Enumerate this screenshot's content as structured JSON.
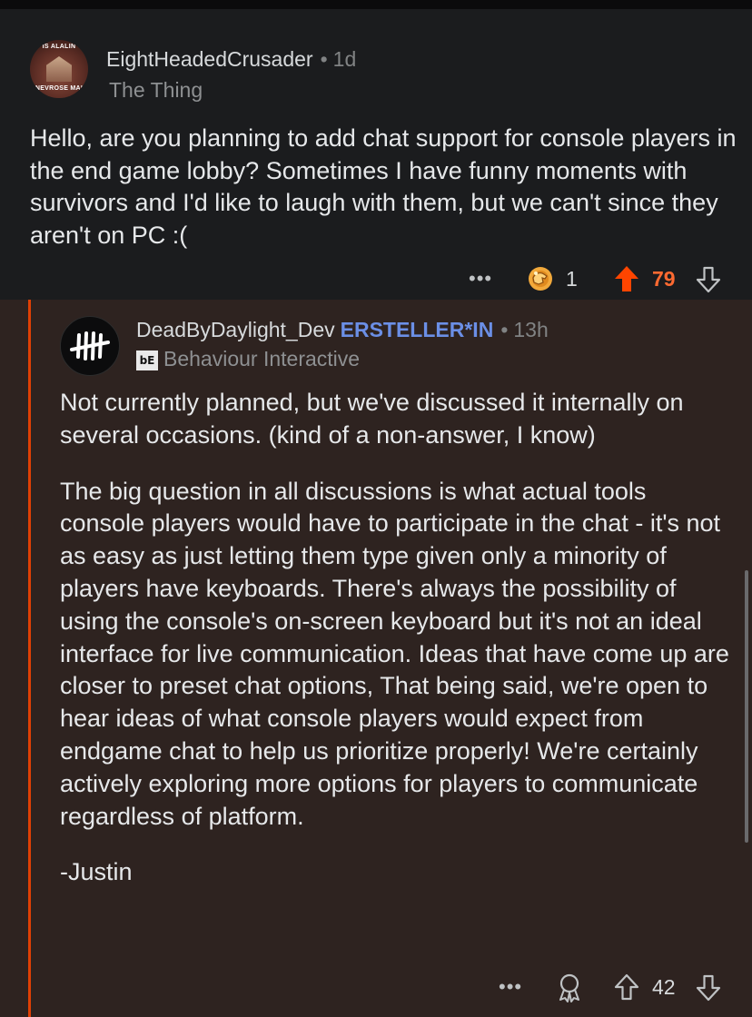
{
  "comments": [
    {
      "author": "EightHeadedCrusader",
      "separator": "•",
      "age": "1d",
      "flair": "The Thing",
      "avatar_text_top": "IS ALALIN",
      "avatar_text_bottom": "NEVROSE MAI",
      "body": "Hello, are you planning to add chat support for console players in the end game lobby? Sometimes I have funny moments with survivors and I'd like to laugh with them, but we can't since they aren't on PC :(",
      "more_label": "•••",
      "award_count": "1",
      "score": "79",
      "upvoted": true
    },
    {
      "author": "DeadByDaylight_Dev",
      "op_tag": "ERSTELLER*IN",
      "separator": "•",
      "age": "13h",
      "flair_badge": "bE",
      "flair": "Behaviour Interactive",
      "paragraphs": [
        "Not currently planned, but we've discussed it internally on several occasions. (kind of a non-answer, I know)",
        "The big question in all discussions is what actual tools console players would have to participate in the chat - it's not as easy as just letting them type given only a minority of players have keyboards. There's always the possibility of using the console's on-screen keyboard but it's not an ideal interface for live communication. Ideas that have come up are closer to preset chat options, That being said, we're open to hear ideas of what console players would expect from endgame chat to help us prioritize properly! We're certainly actively exploring more options for players to communicate regardless of platform.",
        "-Justin"
      ],
      "more_label": "•••",
      "score": "42",
      "upvoted": false
    }
  ],
  "colors": {
    "background": "#1b1c1e",
    "reply_background": "#2e2320",
    "thread_line": "#ff4500",
    "upvote_active": "#ff6a31",
    "op_tag": "#6b8fe6"
  },
  "icons": [
    "more-icon",
    "award-icon",
    "upvote-icon",
    "downvote-icon"
  ]
}
